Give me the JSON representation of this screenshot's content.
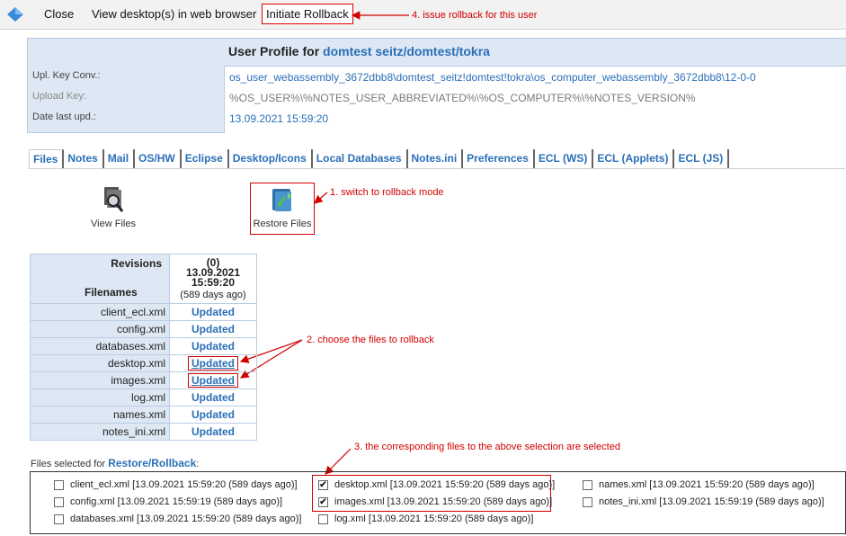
{
  "toolbar": {
    "close": "Close",
    "view_desktop": "View desktop(s) in web browser",
    "initiate_rollback": "Initiate Rollback"
  },
  "annotations": {
    "a4": "4. issue rollback for this user",
    "a1": "1. switch to rollback mode",
    "a2": "2. choose the files to rollback",
    "a3": "3. the corresponding files to the above selection are selected"
  },
  "profile": {
    "title_prefix": "User Profile for",
    "user": "domtest seitz/domtest/tokra",
    "fields": [
      {
        "label": "Upl. Key Conv.:",
        "value": "os_user_webassembly_3672dbb8\\domtest_seitz!domtest!tokra\\os_computer_webassembly_3672dbb8\\12-0-0"
      },
      {
        "label": "Upload Key:",
        "value": "%OS_USER%\\%NOTES_USER_ABBREVIATED%\\%OS_COMPUTER%\\%NOTES_VERSION%"
      },
      {
        "label": "Date last upd.:",
        "value": "13.09.2021 15:59:20"
      }
    ]
  },
  "tabs": [
    "Files",
    "Notes",
    "Mail",
    "OS/HW",
    "Eclipse",
    "Desktop/Icons",
    "Local Databases",
    "Notes.ini",
    "Preferences",
    "ECL (WS)",
    "ECL (Applets)",
    "ECL (JS)"
  ],
  "actions": {
    "view_files": "View Files",
    "restore_files": "Restore Files"
  },
  "revisions": {
    "revisions_label": "Revisions",
    "filenames_label": "Filenames",
    "col_index": "(0)",
    "col_date": "13.09.2021",
    "col_time": "15:59:20",
    "col_age": "(589 days ago)",
    "rows": [
      {
        "file": "client_ecl.xml",
        "status": "Updated"
      },
      {
        "file": "config.xml",
        "status": "Updated"
      },
      {
        "file": "databases.xml",
        "status": "Updated"
      },
      {
        "file": "desktop.xml",
        "status": "Updated"
      },
      {
        "file": "images.xml",
        "status": "Updated"
      },
      {
        "file": "log.xml",
        "status": "Updated"
      },
      {
        "file": "names.xml",
        "status": "Updated"
      },
      {
        "file": "notes_ini.xml",
        "status": "Updated"
      }
    ]
  },
  "selection": {
    "label_prefix": "Files selected for",
    "label_link": "Restore/Rollback",
    "label_suffix": ":",
    "items": [
      {
        "label": "client_ecl.xml [13.09.2021 15:59:20 (589 days ago)]",
        "checked": false
      },
      {
        "label": "config.xml [13.09.2021 15:59:19 (589 days ago)]",
        "checked": false
      },
      {
        "label": "databases.xml [13.09.2021 15:59:20 (589 days ago)]",
        "checked": false
      },
      {
        "label": "desktop.xml [13.09.2021 15:59:20 (589 days ago)]",
        "checked": true
      },
      {
        "label": "images.xml [13.09.2021 15:59:20 (589 days ago)]",
        "checked": true
      },
      {
        "label": "log.xml [13.09.2021 15:59:20 (589 days ago)]",
        "checked": false
      },
      {
        "label": "names.xml [13.09.2021 15:59:20 (589 days ago)]",
        "checked": false
      },
      {
        "label": "notes_ini.xml [13.09.2021 15:59:19 (589 days ago)]",
        "checked": false
      }
    ],
    "check_glyph": "✔"
  },
  "colors": {
    "accent": "#2a6fb7",
    "annotation": "#d00000",
    "panel": "#dde8f4"
  }
}
